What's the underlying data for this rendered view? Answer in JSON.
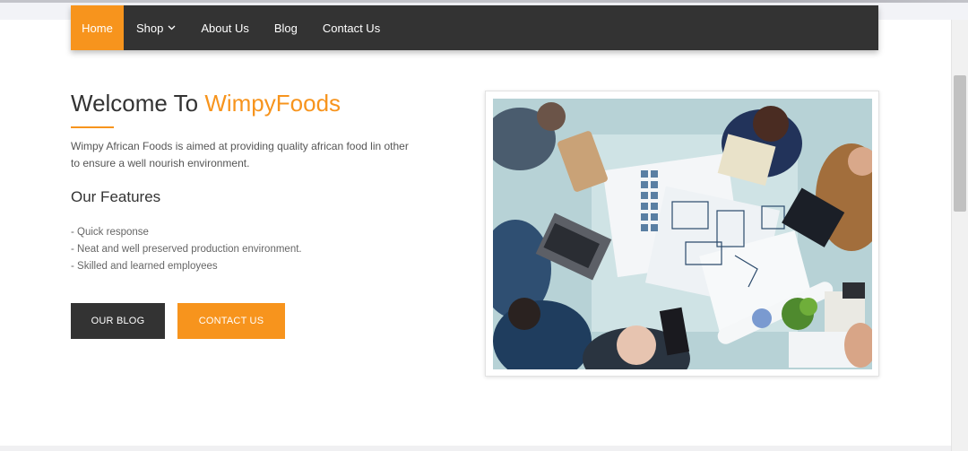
{
  "nav": {
    "items": [
      {
        "label": "Home",
        "active": true
      },
      {
        "label": "Shop",
        "has_dropdown": true
      },
      {
        "label": "About Us"
      },
      {
        "label": "Blog"
      },
      {
        "label": "Contact Us"
      }
    ]
  },
  "hero": {
    "welcome_prefix": "Welcome To ",
    "brand_name": "WimpyFoods",
    "intro_line1": "Wimpy African Foods is aimed at providing quality african food lin other",
    "intro_line2": "to ensure a well nourish environment.",
    "features_title": "Our Features",
    "features": [
      "- Quick response",
      "- Neat and well preserved production environment.",
      "- Skilled and learned employees"
    ],
    "blog_button": "OUR BLOG",
    "contact_button": "CONTACT US"
  },
  "colors": {
    "accent": "#f7941d",
    "nav_bg": "#333333",
    "dark_button": "#333333"
  },
  "icons": {
    "shop_dropdown": "chevron-down-icon"
  },
  "photo": {
    "subject": "team-meeting-photo"
  }
}
